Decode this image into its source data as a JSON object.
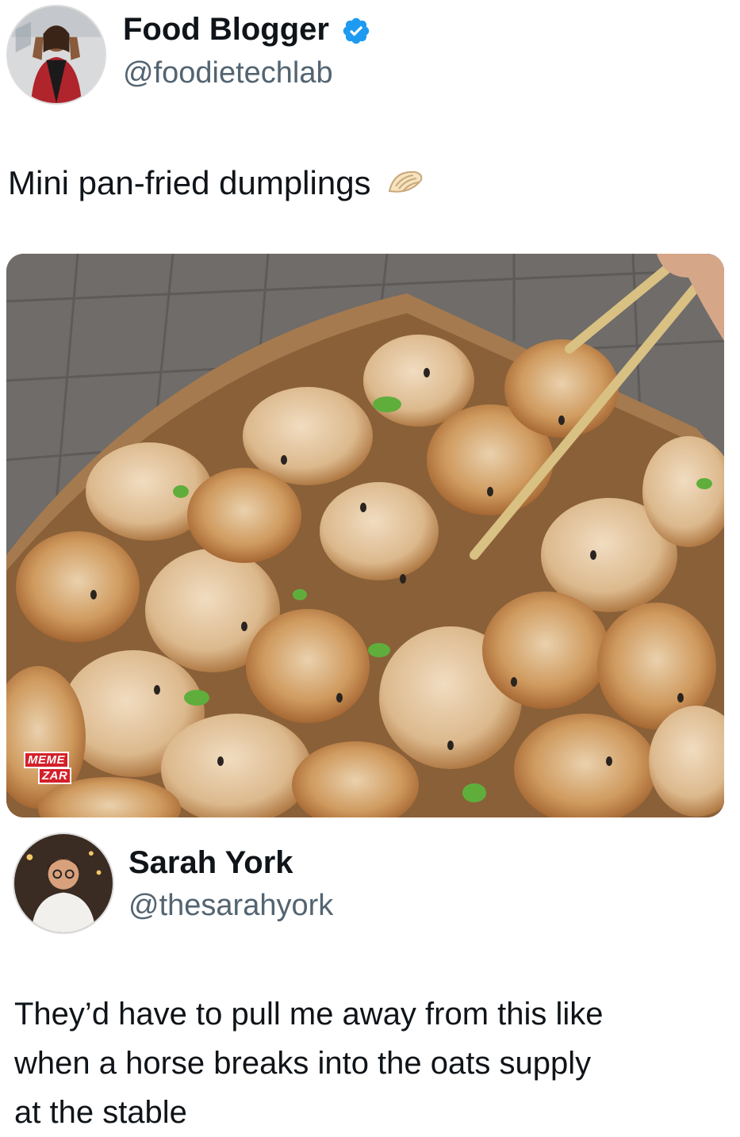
{
  "tweet": {
    "author": {
      "name": "Food Blogger",
      "handle": "@foodietechlab",
      "verified": true
    },
    "text": "Mini pan-fried dumplings",
    "emoji": "🥟",
    "media": {
      "description_icon": "dumplings-photo",
      "watermark_line1": "MEME",
      "watermark_line2": "ZAR"
    }
  },
  "reply": {
    "author": {
      "name": "Sarah York",
      "handle": "@thesarahyork"
    },
    "text_line1": "They’d have to pull me away from this like",
    "text_line2": "when a horse breaks into the oats supply",
    "text_line3": "at the stable"
  },
  "colors": {
    "verified_blue": "#1d9bf0",
    "text_primary": "#0f1419",
    "text_secondary": "#536471",
    "watermark_red": "#d4202a"
  }
}
